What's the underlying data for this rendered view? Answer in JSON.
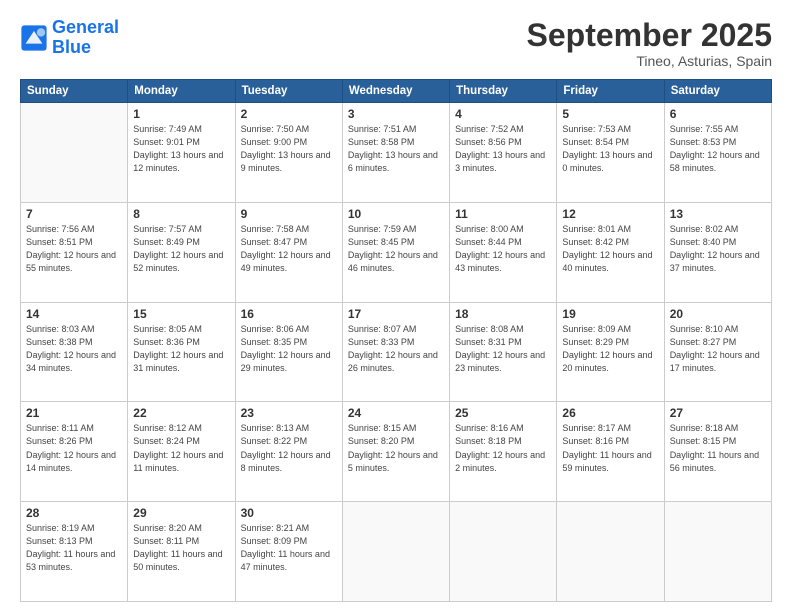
{
  "header": {
    "logo_line1": "General",
    "logo_line2": "Blue",
    "month": "September 2025",
    "location": "Tineo, Asturias, Spain"
  },
  "days_of_week": [
    "Sunday",
    "Monday",
    "Tuesday",
    "Wednesday",
    "Thursday",
    "Friday",
    "Saturday"
  ],
  "weeks": [
    [
      {
        "day": "",
        "sunrise": "",
        "sunset": "",
        "daylight": ""
      },
      {
        "day": "1",
        "sunrise": "Sunrise: 7:49 AM",
        "sunset": "Sunset: 9:01 PM",
        "daylight": "Daylight: 13 hours and 12 minutes."
      },
      {
        "day": "2",
        "sunrise": "Sunrise: 7:50 AM",
        "sunset": "Sunset: 9:00 PM",
        "daylight": "Daylight: 13 hours and 9 minutes."
      },
      {
        "day": "3",
        "sunrise": "Sunrise: 7:51 AM",
        "sunset": "Sunset: 8:58 PM",
        "daylight": "Daylight: 13 hours and 6 minutes."
      },
      {
        "day": "4",
        "sunrise": "Sunrise: 7:52 AM",
        "sunset": "Sunset: 8:56 PM",
        "daylight": "Daylight: 13 hours and 3 minutes."
      },
      {
        "day": "5",
        "sunrise": "Sunrise: 7:53 AM",
        "sunset": "Sunset: 8:54 PM",
        "daylight": "Daylight: 13 hours and 0 minutes."
      },
      {
        "day": "6",
        "sunrise": "Sunrise: 7:55 AM",
        "sunset": "Sunset: 8:53 PM",
        "daylight": "Daylight: 12 hours and 58 minutes."
      }
    ],
    [
      {
        "day": "7",
        "sunrise": "Sunrise: 7:56 AM",
        "sunset": "Sunset: 8:51 PM",
        "daylight": "Daylight: 12 hours and 55 minutes."
      },
      {
        "day": "8",
        "sunrise": "Sunrise: 7:57 AM",
        "sunset": "Sunset: 8:49 PM",
        "daylight": "Daylight: 12 hours and 52 minutes."
      },
      {
        "day": "9",
        "sunrise": "Sunrise: 7:58 AM",
        "sunset": "Sunset: 8:47 PM",
        "daylight": "Daylight: 12 hours and 49 minutes."
      },
      {
        "day": "10",
        "sunrise": "Sunrise: 7:59 AM",
        "sunset": "Sunset: 8:45 PM",
        "daylight": "Daylight: 12 hours and 46 minutes."
      },
      {
        "day": "11",
        "sunrise": "Sunrise: 8:00 AM",
        "sunset": "Sunset: 8:44 PM",
        "daylight": "Daylight: 12 hours and 43 minutes."
      },
      {
        "day": "12",
        "sunrise": "Sunrise: 8:01 AM",
        "sunset": "Sunset: 8:42 PM",
        "daylight": "Daylight: 12 hours and 40 minutes."
      },
      {
        "day": "13",
        "sunrise": "Sunrise: 8:02 AM",
        "sunset": "Sunset: 8:40 PM",
        "daylight": "Daylight: 12 hours and 37 minutes."
      }
    ],
    [
      {
        "day": "14",
        "sunrise": "Sunrise: 8:03 AM",
        "sunset": "Sunset: 8:38 PM",
        "daylight": "Daylight: 12 hours and 34 minutes."
      },
      {
        "day": "15",
        "sunrise": "Sunrise: 8:05 AM",
        "sunset": "Sunset: 8:36 PM",
        "daylight": "Daylight: 12 hours and 31 minutes."
      },
      {
        "day": "16",
        "sunrise": "Sunrise: 8:06 AM",
        "sunset": "Sunset: 8:35 PM",
        "daylight": "Daylight: 12 hours and 29 minutes."
      },
      {
        "day": "17",
        "sunrise": "Sunrise: 8:07 AM",
        "sunset": "Sunset: 8:33 PM",
        "daylight": "Daylight: 12 hours and 26 minutes."
      },
      {
        "day": "18",
        "sunrise": "Sunrise: 8:08 AM",
        "sunset": "Sunset: 8:31 PM",
        "daylight": "Daylight: 12 hours and 23 minutes."
      },
      {
        "day": "19",
        "sunrise": "Sunrise: 8:09 AM",
        "sunset": "Sunset: 8:29 PM",
        "daylight": "Daylight: 12 hours and 20 minutes."
      },
      {
        "day": "20",
        "sunrise": "Sunrise: 8:10 AM",
        "sunset": "Sunset: 8:27 PM",
        "daylight": "Daylight: 12 hours and 17 minutes."
      }
    ],
    [
      {
        "day": "21",
        "sunrise": "Sunrise: 8:11 AM",
        "sunset": "Sunset: 8:26 PM",
        "daylight": "Daylight: 12 hours and 14 minutes."
      },
      {
        "day": "22",
        "sunrise": "Sunrise: 8:12 AM",
        "sunset": "Sunset: 8:24 PM",
        "daylight": "Daylight: 12 hours and 11 minutes."
      },
      {
        "day": "23",
        "sunrise": "Sunrise: 8:13 AM",
        "sunset": "Sunset: 8:22 PM",
        "daylight": "Daylight: 12 hours and 8 minutes."
      },
      {
        "day": "24",
        "sunrise": "Sunrise: 8:15 AM",
        "sunset": "Sunset: 8:20 PM",
        "daylight": "Daylight: 12 hours and 5 minutes."
      },
      {
        "day": "25",
        "sunrise": "Sunrise: 8:16 AM",
        "sunset": "Sunset: 8:18 PM",
        "daylight": "Daylight: 12 hours and 2 minutes."
      },
      {
        "day": "26",
        "sunrise": "Sunrise: 8:17 AM",
        "sunset": "Sunset: 8:16 PM",
        "daylight": "Daylight: 11 hours and 59 minutes."
      },
      {
        "day": "27",
        "sunrise": "Sunrise: 8:18 AM",
        "sunset": "Sunset: 8:15 PM",
        "daylight": "Daylight: 11 hours and 56 minutes."
      }
    ],
    [
      {
        "day": "28",
        "sunrise": "Sunrise: 8:19 AM",
        "sunset": "Sunset: 8:13 PM",
        "daylight": "Daylight: 11 hours and 53 minutes."
      },
      {
        "day": "29",
        "sunrise": "Sunrise: 8:20 AM",
        "sunset": "Sunset: 8:11 PM",
        "daylight": "Daylight: 11 hours and 50 minutes."
      },
      {
        "day": "30",
        "sunrise": "Sunrise: 8:21 AM",
        "sunset": "Sunset: 8:09 PM",
        "daylight": "Daylight: 11 hours and 47 minutes."
      },
      {
        "day": "",
        "sunrise": "",
        "sunset": "",
        "daylight": ""
      },
      {
        "day": "",
        "sunrise": "",
        "sunset": "",
        "daylight": ""
      },
      {
        "day": "",
        "sunrise": "",
        "sunset": "",
        "daylight": ""
      },
      {
        "day": "",
        "sunrise": "",
        "sunset": "",
        "daylight": ""
      }
    ]
  ]
}
